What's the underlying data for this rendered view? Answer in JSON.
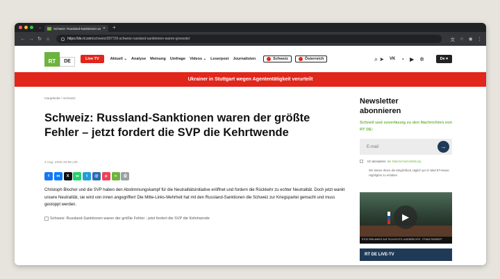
{
  "browser": {
    "tab_title": "Schweiz: Russland-Sanktionen waren...",
    "url_host": "https://de.rt.com",
    "url_path": "/schweiz/287726-schweiz-russland-sanktionen-waren-groesste/"
  },
  "header": {
    "logo_rt": "RT",
    "logo_de": "DE",
    "live_label": "Live TV",
    "nav": [
      "Aktuell ⌄",
      "Analyse",
      "Meinung",
      "Umfrage",
      "Videos ⌄",
      "Leserpost",
      "Journalisten"
    ],
    "pill_ch": "Schweiz",
    "pill_at": "Österreich",
    "lang": "De ▾"
  },
  "banner": "Ukrainer in Stuttgart wegen Agententätigkeit verurteilt",
  "article": {
    "breadcrumb": "Hauptseite  /  Schweiz",
    "headline": "Schweiz: Russland-Sanktionen waren der größte Fehler – jetzt fordert die SVP die Kehrtwende",
    "date": "4 Aug. 2025 20:56 Uhr",
    "lead": "Christoph Blocher und die SVP haben den Abstimmungskampf für die Neutralitätsinitiative eröffnet und fordern die Rückkehr zu echter Neutralität. Doch jetzt wankt unsere Neutralität, sie wird von innen angegriffen! Die Mitte-Links-Mehrheit hat mit den Russland-Sanktionen die Schweiz zur Kriegspartei gemacht und muss gestoppt werden.",
    "image_alt": "Schweiz: Russland-Sanktionen waren der größte Fehler - jetzt fordert die SVP die Kehrtwende"
  },
  "share": [
    {
      "icon": "facebook-icon",
      "glyph": "f",
      "color": "#1877f2"
    },
    {
      "icon": "messenger-icon",
      "glyph": "m",
      "color": "#0a7cff"
    },
    {
      "icon": "x-icon",
      "glyph": "X",
      "color": "#111111"
    },
    {
      "icon": "whatsapp-icon",
      "glyph": "w",
      "color": "#25d366"
    },
    {
      "icon": "telegram-icon",
      "glyph": "t",
      "color": "#229ed9"
    },
    {
      "icon": "email-icon",
      "glyph": "@",
      "color": "#2b6cb0"
    },
    {
      "icon": "pocket-icon",
      "glyph": "p",
      "color": "#ef4056"
    },
    {
      "icon": "link-icon",
      "glyph": "∞",
      "color": "#6db33f"
    },
    {
      "icon": "print-icon",
      "glyph": "⎙",
      "color": "#9aa0a6"
    }
  ],
  "sidebar": {
    "newsletter_title": "Newsletter abonnieren",
    "newsletter_sub": "Schnell und zuverlässig zu den Nachrichten von RT DE:",
    "email_placeholder": "E-mail",
    "consent_text": "Ich akzeptiere",
    "consent_link": "die Datenschutzerklärung",
    "note": "Wir bieten Ihnen die Möglichkeit, täglich per E-Mail RT-News-Highlights zu erhalten",
    "video_ticker": "RTDE  PARLAMENT AUF SCHLECHTE LAGEBERICHTE · ETWAS PASSIERT",
    "live_tv": "RT DE LIVE-TV"
  }
}
